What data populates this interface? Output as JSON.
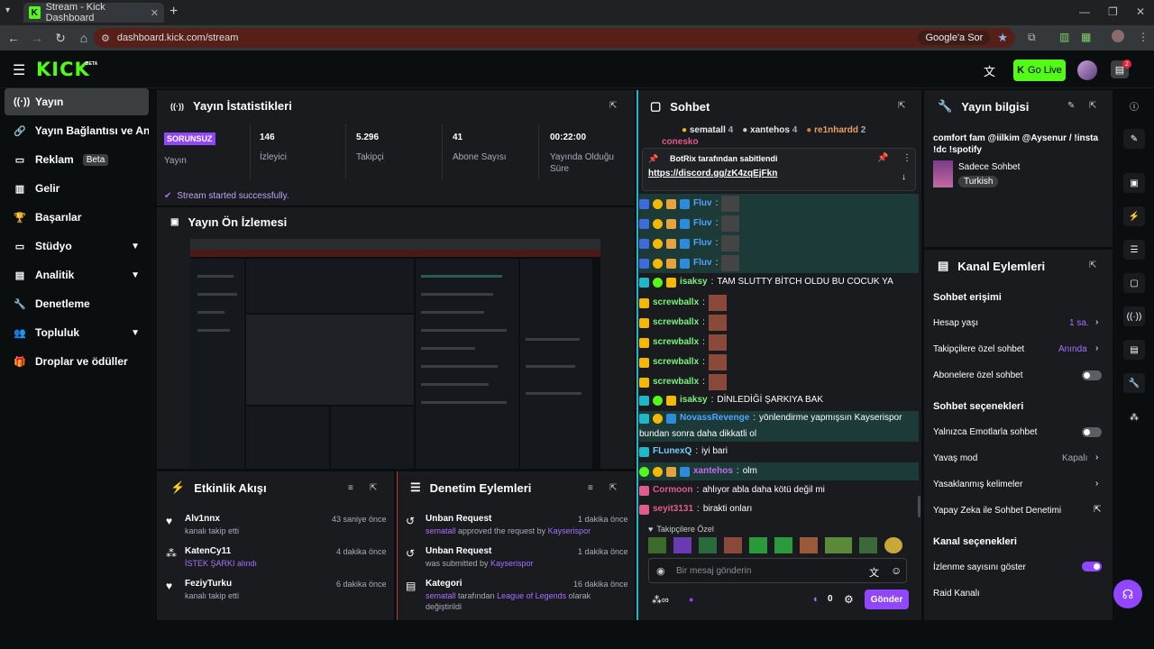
{
  "browser": {
    "tab_title": "Stream - Kick Dashboard",
    "url": "dashboard.kick.com/stream",
    "lens_label": "Google'a Sor"
  },
  "header": {
    "logo": "KICK",
    "logo_sup": "BETA",
    "go_live": "Go Live",
    "notif_count": "2"
  },
  "sidebar": {
    "items": [
      {
        "label": "Yayın",
        "icon": "broadcast-icon"
      },
      {
        "label": "Yayın Bağlantısı ve Anahtarı",
        "icon": "link-icon"
      },
      {
        "label": "Reklam",
        "icon": "ad-icon",
        "badge": "Beta"
      },
      {
        "label": "Gelir",
        "icon": "revenue-icon"
      },
      {
        "label": "Başarılar",
        "icon": "trophy-icon"
      },
      {
        "label": "Stüdyo",
        "icon": "studio-icon"
      },
      {
        "label": "Analitik",
        "icon": "analytics-icon"
      },
      {
        "label": "Denetleme",
        "icon": "wrench-icon"
      },
      {
        "label": "Topluluk",
        "icon": "community-icon"
      },
      {
        "label": "Droplar ve ödüller",
        "icon": "drops-icon"
      }
    ]
  },
  "stats": {
    "title": "Yayın İstatistikleri",
    "status_badge": "SORUNSUZ",
    "status_label": "Yayın",
    "viewers": "146",
    "viewers_label": "İzleyici",
    "followers": "5.296",
    "followers_label": "Takipçi",
    "subs": "41",
    "subs_label": "Abone Sayısı",
    "uptime": "00:22:00",
    "uptime_label_1": "Yayında Olduğu",
    "uptime_label_2": "Süre",
    "success": "Stream started successfully."
  },
  "preview": {
    "title": "Yayın Ön İzlemesi"
  },
  "activity": {
    "title": "Etkinlik Akışı",
    "events": [
      {
        "name": "Alv1nnx",
        "sub": "kanalı takip etti",
        "time": "43 saniye önce",
        "icon": "heart-icon"
      },
      {
        "name": "KatenCy11",
        "sub": "İSTEK ŞARKI alındı",
        "time": "4 dakika önce",
        "icon": "points-icon"
      },
      {
        "name": "FeziyTurku",
        "sub": "kanalı takip etti",
        "time": "6 dakika önce",
        "icon": "heart-icon"
      }
    ]
  },
  "moderation": {
    "title": "Denetim Eylemleri",
    "actions": [
      {
        "name": "Unban Request",
        "user": "sematall",
        "sub": "approved the request by",
        "target": "Kayserispor",
        "time": "1 dakika önce"
      },
      {
        "name": "Unban Request",
        "sub": "was submitted by",
        "target": "Kayserispor",
        "time": "1 dakika önce"
      },
      {
        "name": "Kategori",
        "user": "sematall",
        "sub": "tarafından",
        "target": "League of Legends",
        "sub2": "olarak",
        "sub3": "değiştirildi",
        "time": "16 dakika önce"
      }
    ]
  },
  "chat": {
    "title": "Sohbet",
    "top": [
      {
        "name": "sematall",
        "count": "4"
      },
      {
        "name": "xantehos",
        "count": "4"
      },
      {
        "name": "re1nhardd",
        "count": "2"
      }
    ],
    "partial_name": "conesko",
    "pinned_by": "BotRix tarafından sabitlendi",
    "pinned_link": "https://discord.gg/zK4zqEjFkn",
    "messages": [
      {
        "user": "Fluv",
        "text": ""
      },
      {
        "user": "Fluv",
        "text": ""
      },
      {
        "user": "Fluv",
        "text": ""
      },
      {
        "user": "Fluv",
        "text": ""
      },
      {
        "user": "isaksy",
        "text": "TAM SLUTTY BİTCH OLDU BU COCUK YA"
      },
      {
        "user": "screwballx",
        "text": ""
      },
      {
        "user": "screwballx",
        "text": ""
      },
      {
        "user": "screwballx",
        "text": ""
      },
      {
        "user": "screwballx",
        "text": ""
      },
      {
        "user": "screwballx",
        "text": ""
      },
      {
        "user": "isaksy",
        "text": "DİNLEDİĞİ ŞARKIYA BAK"
      },
      {
        "user": "NovassRevenge",
        "text": "yönlendirme yapmışsın Kayserispor",
        "text2": "bundan sonra daha dikkatli ol"
      },
      {
        "user": "FLunexQ",
        "text": "iyi bari"
      },
      {
        "user": "xantehos",
        "text": "olm"
      },
      {
        "user": "Cormoon",
        "text": "ahlıyor abla daha kötü değil mi"
      },
      {
        "user": "seyit3131",
        "text": "birakti onları"
      }
    ],
    "followers_only": "Takipçilere Özel",
    "placeholder": "Bir mesaj gönderin",
    "points": "0",
    "send": "Gönder"
  },
  "stream_info": {
    "title": "Yayın bilgisi",
    "stream_title_1": "comfort fam @iilkim @Aysenur / !insta",
    "stream_title_2": "!dc !spotify",
    "category": "Sadece Sohbet",
    "tag": "Turkish"
  },
  "channel_actions": {
    "title": "Kanal Eylemleri",
    "chat_access": "Sohbet erişimi",
    "account_age": "Hesap yaşı",
    "account_age_val": "1 sa.",
    "followers_chat": "Takipçilere özel sohbet",
    "followers_chat_val": "Anında",
    "subs_chat": "Abonelere özel sohbet",
    "chat_options": "Sohbet seçenekleri",
    "emote_only": "Yalnızca Emotlarla sohbet",
    "slow_mode": "Yavaş mod",
    "slow_mode_val": "Kapalı",
    "banned_words": "Yasaklanmış kelimeler",
    "ai_mod": "Yapay Zeka ile Sohbet Denetimi",
    "channel_options": "Kanal seçenekleri",
    "show_viewers": "İzlenme sayısını göster",
    "raid": "Raid Kanalı"
  },
  "colors": {
    "accent": "#53fc18",
    "purple": "#9147ff",
    "panel": "#191b1f"
  }
}
